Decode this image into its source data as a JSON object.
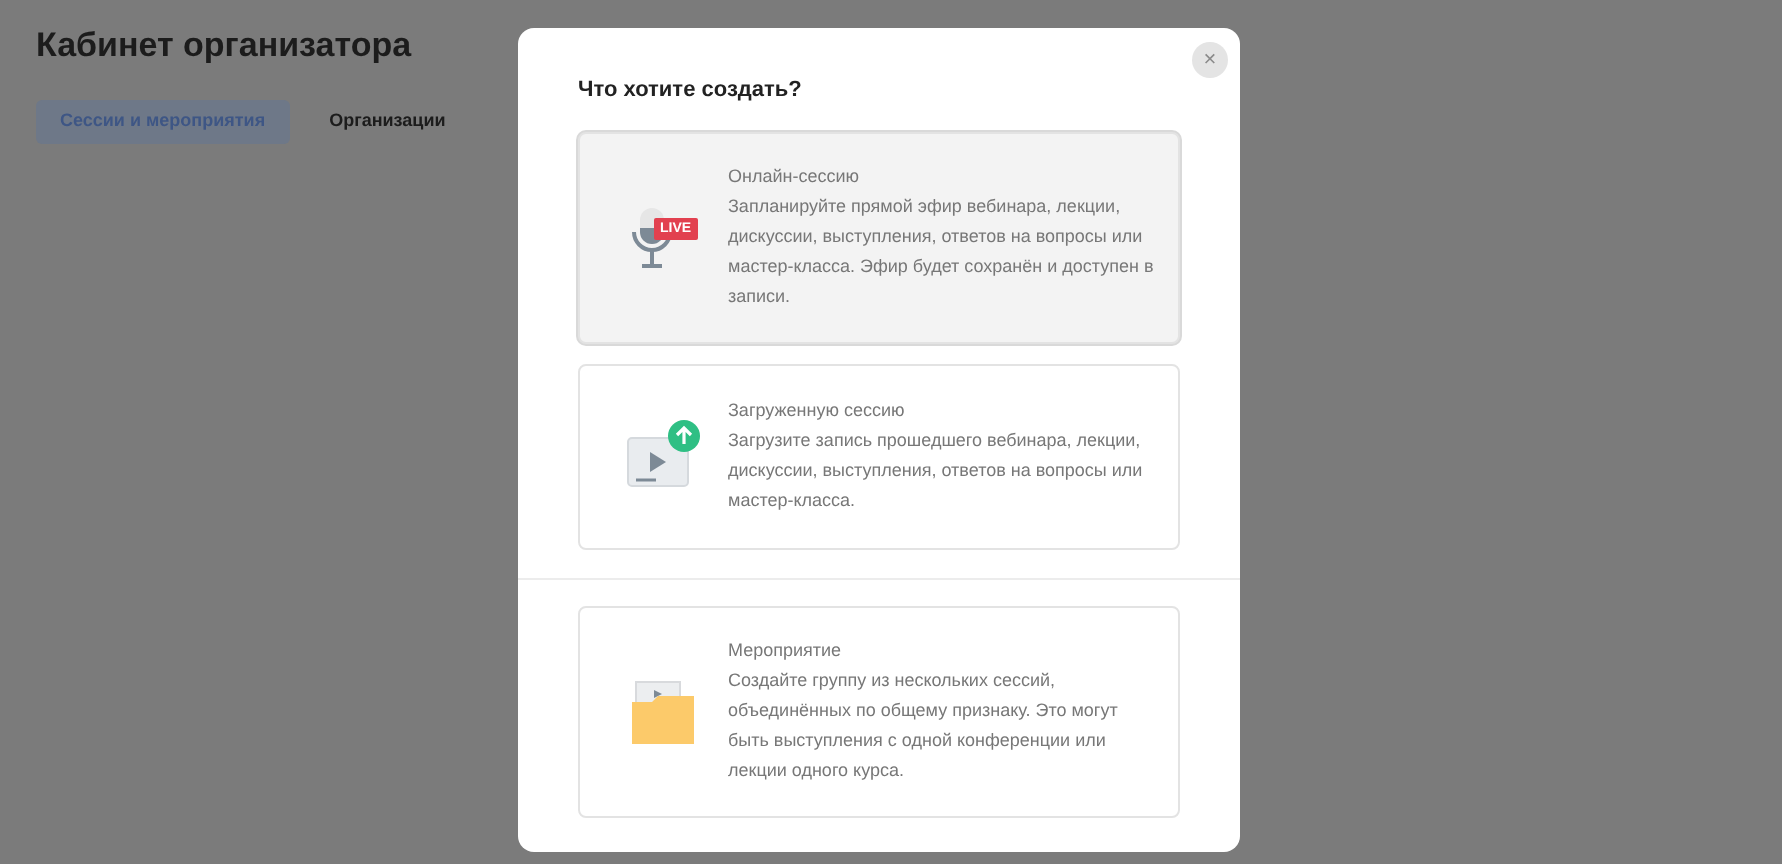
{
  "page": {
    "title": "Кабинет организатора"
  },
  "tabs": [
    {
      "label": "Сессии и мероприятия",
      "selected": true
    },
    {
      "label": "Организации",
      "selected": false
    }
  ],
  "dialog": {
    "title": "Что хотите создать?",
    "close": "×",
    "options": [
      {
        "kind": "live",
        "badge": "LIVE",
        "title": "Онлайн-сессию",
        "description": "Запланируйте прямой эфир вебинара, лекции, дискуссии, выступления, ответов на вопросы или мастер-класса. Эфир будет сохранён и доступен в записи.",
        "selected": true
      },
      {
        "kind": "upload",
        "title": "Загруженную сессию",
        "description": "Загрузите запись прошедшего вебинара, лекции, дискуссии, выступления, ответов на вопросы или мастер-класса.",
        "selected": false
      },
      {
        "kind": "event",
        "title": "Мероприятие",
        "description": "Создайте группу из нескольких сессий, объединённых по общему признаку. Это могут быть выступления с одной конференции или лекции одного курса.",
        "selected": false
      }
    ]
  }
}
